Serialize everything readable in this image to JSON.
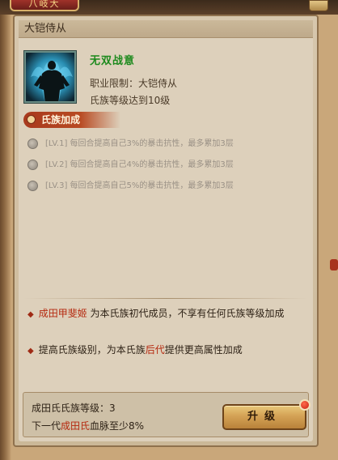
{
  "window": {
    "tab_title": "八岐大"
  },
  "panel": {
    "header_title": "大铠侍从"
  },
  "skill": {
    "name": "无双战意",
    "requirement_job": "职业限制：大铠侍从",
    "requirement_clan": "氏族等级达到10级"
  },
  "clan_bonus": {
    "title": "氏族加成",
    "levels": [
      {
        "text": "[LV.1] 每回合提高自己3%的暴击抗性，最多累加3层"
      },
      {
        "text": "[LV.2] 每回合提高自己4%的暴击抗性，最多累加3层"
      },
      {
        "text": "[LV.3] 每回合提高自己5%的暴击抗性，最多累加3层"
      }
    ]
  },
  "notes": {
    "bullet": "◆",
    "note1_name": "成田甲斐姬",
    "note1_rest": " 为本氏族初代成员，不享有任何氏族等级加成",
    "note2_pre": "提高氏族级别，为本氏族",
    "note2_highlight": "后代",
    "note2_post": "提供更高属性加成"
  },
  "status": {
    "clan_level_label": "成田氏氏族等级：",
    "clan_level_value": "3",
    "next_gen_pre": "下一代",
    "next_gen_clan": "成田氏",
    "next_gen_post": "血脉至少8%"
  },
  "actions": {
    "upgrade_label": "升级"
  },
  "colors": {
    "skill_name": "#1d8a1d",
    "highlight_red": "#b5290f",
    "banner": "#b84a22"
  }
}
